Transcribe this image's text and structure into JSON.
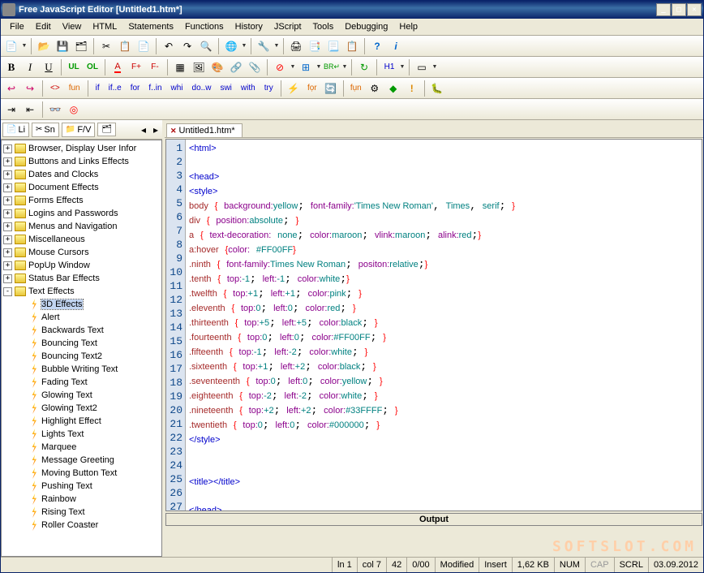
{
  "window": {
    "title": "Free JavaScript Editor    [Untitled1.htm*]"
  },
  "menu": [
    "File",
    "Edit",
    "View",
    "HTML",
    "Statements",
    "Functions",
    "History",
    "JScript",
    "Tools",
    "Debugging",
    "Help"
  ],
  "toolbar3": {
    "bold": "B",
    "italic": "I",
    "underline": "U",
    "ul": "UL",
    "ol": "OL",
    "font": "A",
    "fplus": "F+",
    "fminus": "F-",
    "h1": "H1"
  },
  "toolbar4": {
    "items": [
      "<>",
      "fun",
      "if",
      "if..e",
      "for",
      "f..in",
      "whi",
      "do..w",
      "swi",
      "with",
      "try"
    ]
  },
  "sidebar_tabs": [
    "Li",
    "Sn",
    "F/V"
  ],
  "tree": [
    {
      "label": "Browser, Display User Infor",
      "type": "folder",
      "exp": "+",
      "depth": 0
    },
    {
      "label": "Buttons and Links Effects",
      "type": "folder",
      "exp": "+",
      "depth": 0
    },
    {
      "label": "Dates and Clocks",
      "type": "folder",
      "exp": "+",
      "depth": 0
    },
    {
      "label": "Document Effects",
      "type": "folder",
      "exp": "+",
      "depth": 0
    },
    {
      "label": "Forms Effects",
      "type": "folder",
      "exp": "+",
      "depth": 0
    },
    {
      "label": "Logins and Passwords",
      "type": "folder",
      "exp": "+",
      "depth": 0
    },
    {
      "label": "Menus and Navigation",
      "type": "folder",
      "exp": "+",
      "depth": 0
    },
    {
      "label": "Miscellaneous",
      "type": "folder",
      "exp": "+",
      "depth": 0
    },
    {
      "label": "Mouse Cursors",
      "type": "folder",
      "exp": "+",
      "depth": 0
    },
    {
      "label": "PopUp Window",
      "type": "folder",
      "exp": "+",
      "depth": 0
    },
    {
      "label": "Status Bar Effects",
      "type": "folder",
      "exp": "+",
      "depth": 0
    },
    {
      "label": "Text Effects",
      "type": "folder",
      "exp": "-",
      "depth": 0
    },
    {
      "label": "3D Effects",
      "type": "effect",
      "depth": 1,
      "selected": true
    },
    {
      "label": "Alert",
      "type": "effect",
      "depth": 1
    },
    {
      "label": "Backwards Text",
      "type": "effect",
      "depth": 1
    },
    {
      "label": "Bouncing Text",
      "type": "effect",
      "depth": 1
    },
    {
      "label": "Bouncing Text2",
      "type": "effect",
      "depth": 1
    },
    {
      "label": "Bubble Writing Text",
      "type": "effect",
      "depth": 1
    },
    {
      "label": "Fading Text",
      "type": "effect",
      "depth": 1
    },
    {
      "label": "Glowing Text",
      "type": "effect",
      "depth": 1
    },
    {
      "label": "Glowing Text2",
      "type": "effect",
      "depth": 1
    },
    {
      "label": "Highlight Effect",
      "type": "effect",
      "depth": 1
    },
    {
      "label": "Lights Text",
      "type": "effect",
      "depth": 1
    },
    {
      "label": "Marquee",
      "type": "effect",
      "depth": 1
    },
    {
      "label": "Message Greeting",
      "type": "effect",
      "depth": 1
    },
    {
      "label": "Moving Button Text",
      "type": "effect",
      "depth": 1
    },
    {
      "label": "Pushing Text",
      "type": "effect",
      "depth": 1
    },
    {
      "label": "Rainbow",
      "type": "effect",
      "depth": 1
    },
    {
      "label": "Rising Text",
      "type": "effect",
      "depth": 1
    },
    {
      "label": "Roller Coaster",
      "type": "effect",
      "depth": 1
    }
  ],
  "editor_tab": "Untitled1.htm*",
  "code_lines": [
    {
      "n": 1,
      "html": "<span class='tag'>&lt;html&gt;</span>"
    },
    {
      "n": 2,
      "html": ""
    },
    {
      "n": 3,
      "html": "<span class='tag'>&lt;head&gt;</span>"
    },
    {
      "n": 4,
      "html": "<span class='tag'>&lt;style&gt;</span>"
    },
    {
      "n": 5,
      "html": "<span class='csssel'>body</span> <span class='brace'>{</span> <span class='prop'>background:</span><span class='val'>yellow</span>; <span class='prop'>font-family:</span><span class='str'>'Times New Roman'</span>, <span class='val'>Times</span>, <span class='val'>serif</span>; <span class='brace'>}</span>"
    },
    {
      "n": 6,
      "html": "<span class='csssel'>div</span> <span class='brace'>{</span> <span class='prop'>position:</span><span class='val'>absolute</span>; <span class='brace'>}</span>"
    },
    {
      "n": 7,
      "html": "<span class='csssel'>a</span> <span class='brace'>{</span> <span class='prop'>text-decoration:</span> <span class='val'>none</span>; <span class='prop'>color:</span><span class='val'>maroon</span>; <span class='prop'>vlink:</span><span class='val'>maroon</span>; <span class='prop'>alink:</span><span class='val'>red</span>;<span class='brace'>}</span>"
    },
    {
      "n": 8,
      "html": "<span class='csssel'>a:hover</span> <span class='brace'>{</span><span class='prop'>color:</span> <span class='val'>#FF00FF</span><span class='brace'>}</span>"
    },
    {
      "n": 9,
      "html": "<span class='csssel'>.ninth</span> <span class='brace'>{</span> <span class='prop'>font-family:</span><span class='val'>Times New Roman</span>; <span class='prop'>positon:</span><span class='val'>relative</span>;<span class='brace'>}</span>"
    },
    {
      "n": 10,
      "html": "<span class='csssel'>.tenth</span> <span class='brace'>{</span> <span class='prop'>top:</span><span class='val'>-1</span>; <span class='prop'>left:</span><span class='val'>-1</span>; <span class='prop'>color:</span><span class='val'>white</span>;<span class='brace'>}</span>"
    },
    {
      "n": 11,
      "html": "<span class='csssel'>.twelfth</span> <span class='brace'>{</span> <span class='prop'>top:</span><span class='val'>+1</span>; <span class='prop'>left:</span><span class='val'>+1</span>; <span class='prop'>color:</span><span class='val'>pink</span>; <span class='brace'>}</span>"
    },
    {
      "n": 12,
      "html": "<span class='csssel'>.eleventh</span> <span class='brace'>{</span> <span class='prop'>top:</span><span class='val'>0</span>; <span class='prop'>left:</span><span class='val'>0</span>; <span class='prop'>color:</span><span class='val'>red</span>; <span class='brace'>}</span>"
    },
    {
      "n": 13,
      "html": "<span class='csssel'>.thirteenth</span> <span class='brace'>{</span> <span class='prop'>top:</span><span class='val'>+5</span>; <span class='prop'>left:</span><span class='val'>+5</span>; <span class='prop'>color:</span><span class='val'>black</span>; <span class='brace'>}</span>"
    },
    {
      "n": 14,
      "html": "<span class='csssel'>.fourteenth</span> <span class='brace'>{</span> <span class='prop'>top:</span><span class='val'>0</span>; <span class='prop'>left:</span><span class='val'>0</span>; <span class='prop'>color:</span><span class='val'>#FF00FF</span>; <span class='brace'>}</span>"
    },
    {
      "n": 15,
      "html": "<span class='csssel'>.fifteenth</span> <span class='brace'>{</span> <span class='prop'>top:</span><span class='val'>-1</span>; <span class='prop'>left:</span><span class='val'>-2</span>; <span class='prop'>color:</span><span class='val'>white</span>; <span class='brace'>}</span>"
    },
    {
      "n": 16,
      "html": "<span class='csssel'>.sixteenth</span> <span class='brace'>{</span> <span class='prop'>top:</span><span class='val'>+1</span>; <span class='prop'>left:</span><span class='val'>+2</span>; <span class='prop'>color:</span><span class='val'>black</span>; <span class='brace'>}</span>"
    },
    {
      "n": 17,
      "html": "<span class='csssel'>.seventeenth</span> <span class='brace'>{</span> <span class='prop'>top:</span><span class='val'>0</span>; <span class='prop'>left:</span><span class='val'>0</span>; <span class='prop'>color:</span><span class='val'>yellow</span>; <span class='brace'>}</span>"
    },
    {
      "n": 18,
      "html": "<span class='csssel'>.eighteenth</span> <span class='brace'>{</span> <span class='prop'>top:</span><span class='val'>-2</span>; <span class='prop'>left:</span><span class='val'>-2</span>; <span class='prop'>color:</span><span class='val'>white</span>; <span class='brace'>}</span>"
    },
    {
      "n": 19,
      "html": "<span class='csssel'>.nineteenth</span> <span class='brace'>{</span> <span class='prop'>top:</span><span class='val'>+2</span>; <span class='prop'>left:</span><span class='val'>+2</span>; <span class='prop'>color:</span><span class='val'>#33FFFF</span>; <span class='brace'>}</span>"
    },
    {
      "n": 20,
      "html": "<span class='csssel'>.twentieth</span> <span class='brace'>{</span> <span class='prop'>top:</span><span class='val'>0</span>; <span class='prop'>left:</span><span class='val'>0</span>; <span class='prop'>color:</span><span class='val'>#000000</span>; <span class='brace'>}</span>"
    },
    {
      "n": 21,
      "html": "<span class='tag'>&lt;/style&gt;</span>"
    },
    {
      "n": 22,
      "html": ""
    },
    {
      "n": 23,
      "html": ""
    },
    {
      "n": 24,
      "html": "<span class='tag'>&lt;title&gt;&lt;/title&gt;</span>"
    },
    {
      "n": 25,
      "html": ""
    },
    {
      "n": 26,
      "html": "<span class='tag'>&lt;/head&gt;</span>"
    },
    {
      "n": 27,
      "html": ""
    }
  ],
  "output_title": "Output",
  "watermark": "SOFTSLOT.COM",
  "status": {
    "ln": "ln 1",
    "col": "col 7",
    "num42": "42",
    "ratio": "0/00",
    "modified": "Modified",
    "insert": "Insert",
    "size": "1,62 KB",
    "num": "NUM",
    "cap": "CAP",
    "scrl": "SCRL",
    "date": "03.09.2012"
  }
}
